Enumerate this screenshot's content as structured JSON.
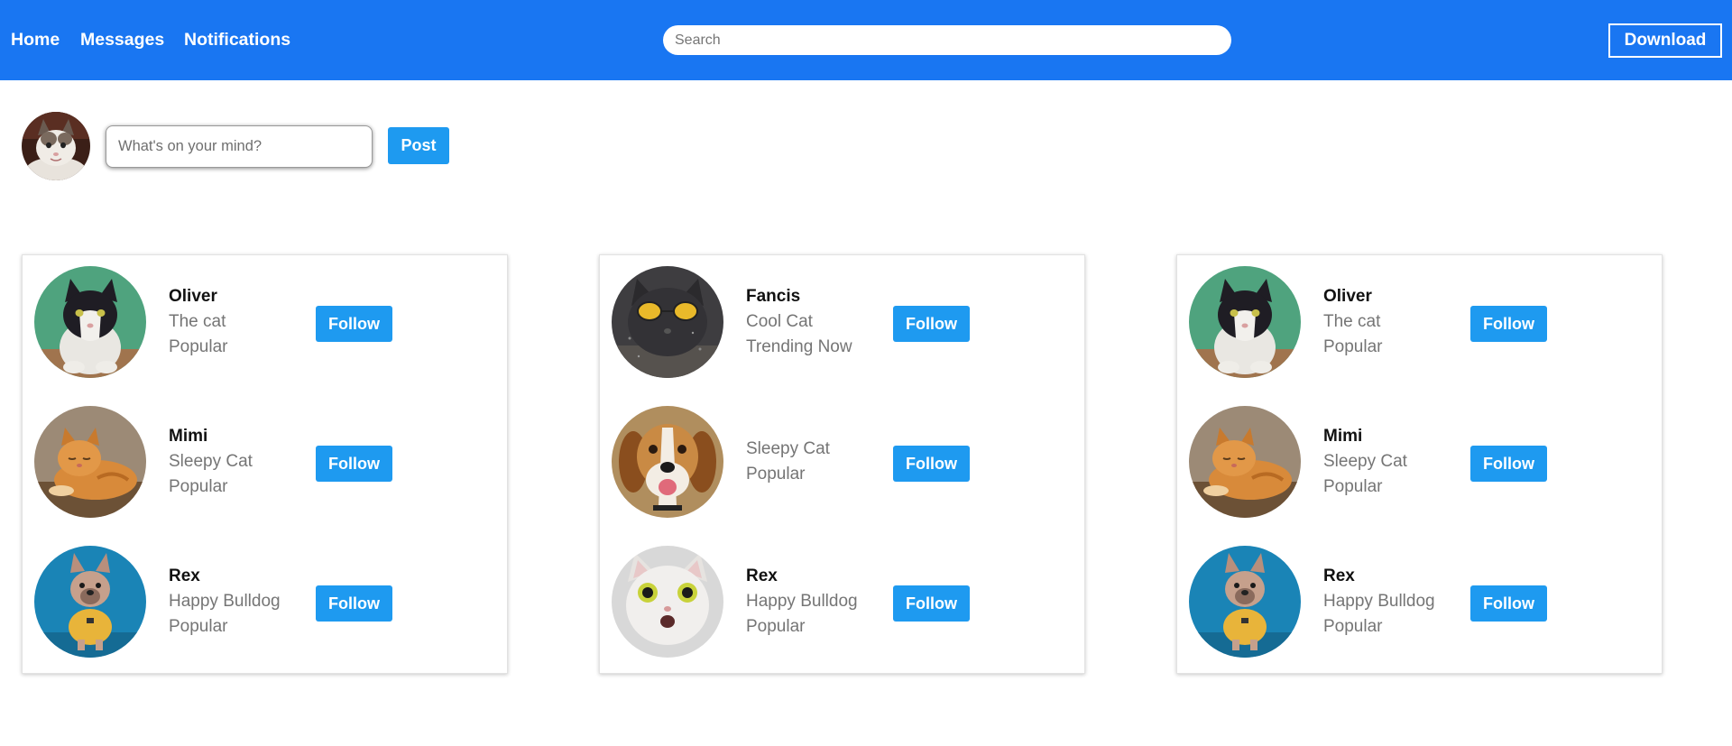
{
  "topbar": {
    "nav": [
      "Home",
      "Messages",
      "Notifications"
    ],
    "search_placeholder": "Search",
    "download_label": "Download",
    "bg_color": "#1976f2"
  },
  "composer": {
    "avatar_icon": "cat-avatar",
    "placeholder": "What's on your mind?",
    "post_label": "Post"
  },
  "accent_color": "#1e9af0",
  "cards": [
    {
      "rows": [
        {
          "name": "Oliver",
          "line1": "The cat",
          "line2": "Popular",
          "follow": "Follow",
          "avatar": "tuxedo-cat"
        },
        {
          "name": "Mimi",
          "line1": "Sleepy Cat",
          "line2": "Popular",
          "follow": "Follow",
          "avatar": "orange-cat"
        },
        {
          "name": "Rex",
          "line1": "Happy Bulldog",
          "line2": "Popular",
          "follow": "Follow",
          "avatar": "french-bulldog"
        }
      ]
    },
    {
      "rows": [
        {
          "name": "Fancis",
          "line1": "Cool Cat",
          "line2": "Trending Now",
          "follow": "Follow",
          "avatar": "cat-sunglasses"
        },
        {
          "name": "",
          "line1": "Sleepy Cat",
          "line2": "Popular",
          "follow": "Follow",
          "avatar": "beagle"
        },
        {
          "name": "Rex",
          "line1": "Happy Bulldog",
          "line2": "Popular",
          "follow": "Follow",
          "avatar": "white-cat"
        }
      ]
    },
    {
      "rows": [
        {
          "name": "Oliver",
          "line1": "The cat",
          "line2": "Popular",
          "follow": "Follow",
          "avatar": "tuxedo-cat"
        },
        {
          "name": "Mimi",
          "line1": "Sleepy Cat",
          "line2": "Popular",
          "follow": "Follow",
          "avatar": "orange-cat"
        },
        {
          "name": "Rex",
          "line1": "Happy Bulldog",
          "line2": "Popular",
          "follow": "Follow",
          "avatar": "french-bulldog"
        }
      ]
    }
  ]
}
